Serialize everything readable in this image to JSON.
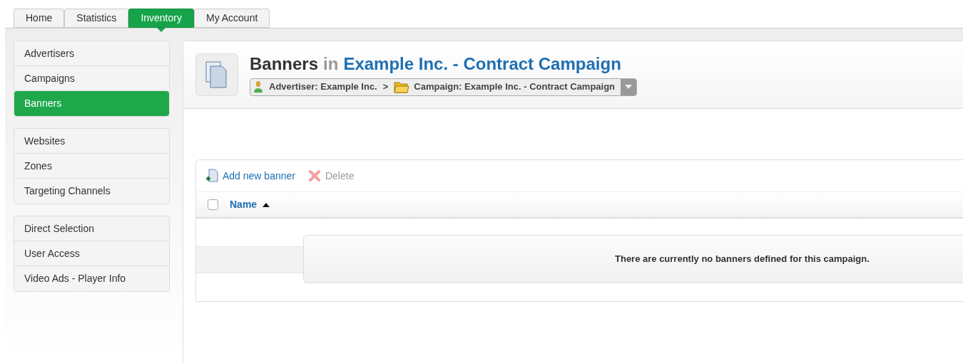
{
  "tabs": [
    {
      "label": "Home",
      "selected": false
    },
    {
      "label": "Statistics",
      "selected": false
    },
    {
      "label": "Inventory",
      "selected": true
    },
    {
      "label": "My Account",
      "selected": false
    }
  ],
  "sidebar": {
    "groups": [
      {
        "items": [
          {
            "label": "Advertisers",
            "selected": false
          },
          {
            "label": "Campaigns",
            "selected": false
          },
          {
            "label": "Banners",
            "selected": true
          }
        ]
      },
      {
        "items": [
          {
            "label": "Websites",
            "selected": false
          },
          {
            "label": "Zones",
            "selected": false
          },
          {
            "label": "Targeting Channels",
            "selected": false
          }
        ]
      },
      {
        "items": [
          {
            "label": "Direct Selection",
            "selected": false
          },
          {
            "label": "User Access",
            "selected": false
          },
          {
            "label": "Video Ads - Player Info",
            "selected": false
          }
        ]
      }
    ]
  },
  "header": {
    "title": "Banners",
    "connector": "in",
    "subject": "Example Inc. - Contract Campaign",
    "breadcrumb": [
      {
        "kind": "advertiser",
        "label": "Advertiser: Example Inc."
      },
      {
        "kind": "separator",
        "label": ">"
      },
      {
        "kind": "campaign",
        "label": "Campaign: Example Inc. - Contract Campaign"
      }
    ]
  },
  "toolbar": [
    {
      "kind": "add",
      "label": "Add new banner",
      "disabled": false
    },
    {
      "kind": "delete",
      "label": "Delete",
      "disabled": true
    }
  ],
  "table": {
    "select_all_checked": false,
    "column": "Name",
    "sort_ascending": true,
    "empty_message": "There are currently no banners defined for this campaign."
  }
}
